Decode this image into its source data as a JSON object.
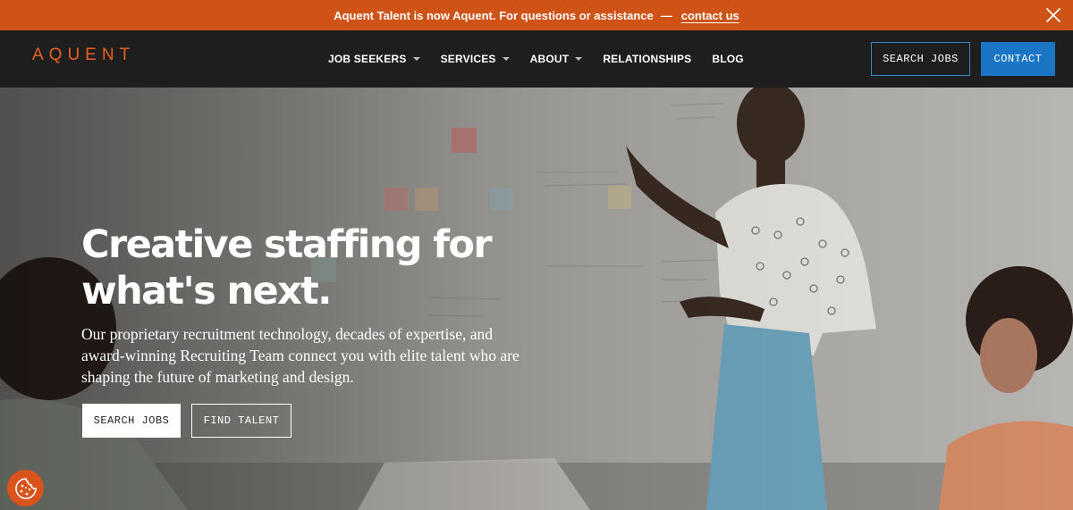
{
  "announcement": {
    "text": "Aquent Talent is now Aquent. For questions or assistance",
    "dash": "—",
    "link": "contact us",
    "close_icon": "close-icon"
  },
  "nav": {
    "logo": "AQUENT",
    "items": [
      {
        "label": "JOB SEEKERS",
        "dropdown": true
      },
      {
        "label": "SERVICES",
        "dropdown": true
      },
      {
        "label": "ABOUT",
        "dropdown": true
      },
      {
        "label": "RELATIONSHIPS",
        "dropdown": false
      },
      {
        "label": "BLOG",
        "dropdown": false
      }
    ],
    "search_jobs": "SEARCH JOBS",
    "contact": "CONTACT"
  },
  "hero": {
    "title_line1": "Creative staffing for",
    "title_line2": "what's next.",
    "text": "Our proprietary recruitment technology, decades of expertise, and award-winning Recruiting Team connect you with elite talent who are shaping the future of marketing and design.",
    "search_jobs": "SEARCH JOBS",
    "find_talent": "FIND TALENT"
  },
  "cookie_icon": "cookie-icon",
  "colors": {
    "announcement_bg": "#cf5316",
    "brand_orange": "#e9601f",
    "nav_bg": "#1e1e1e",
    "contact_blue": "#1a76c4",
    "outline_blue": "#2f87c7"
  }
}
